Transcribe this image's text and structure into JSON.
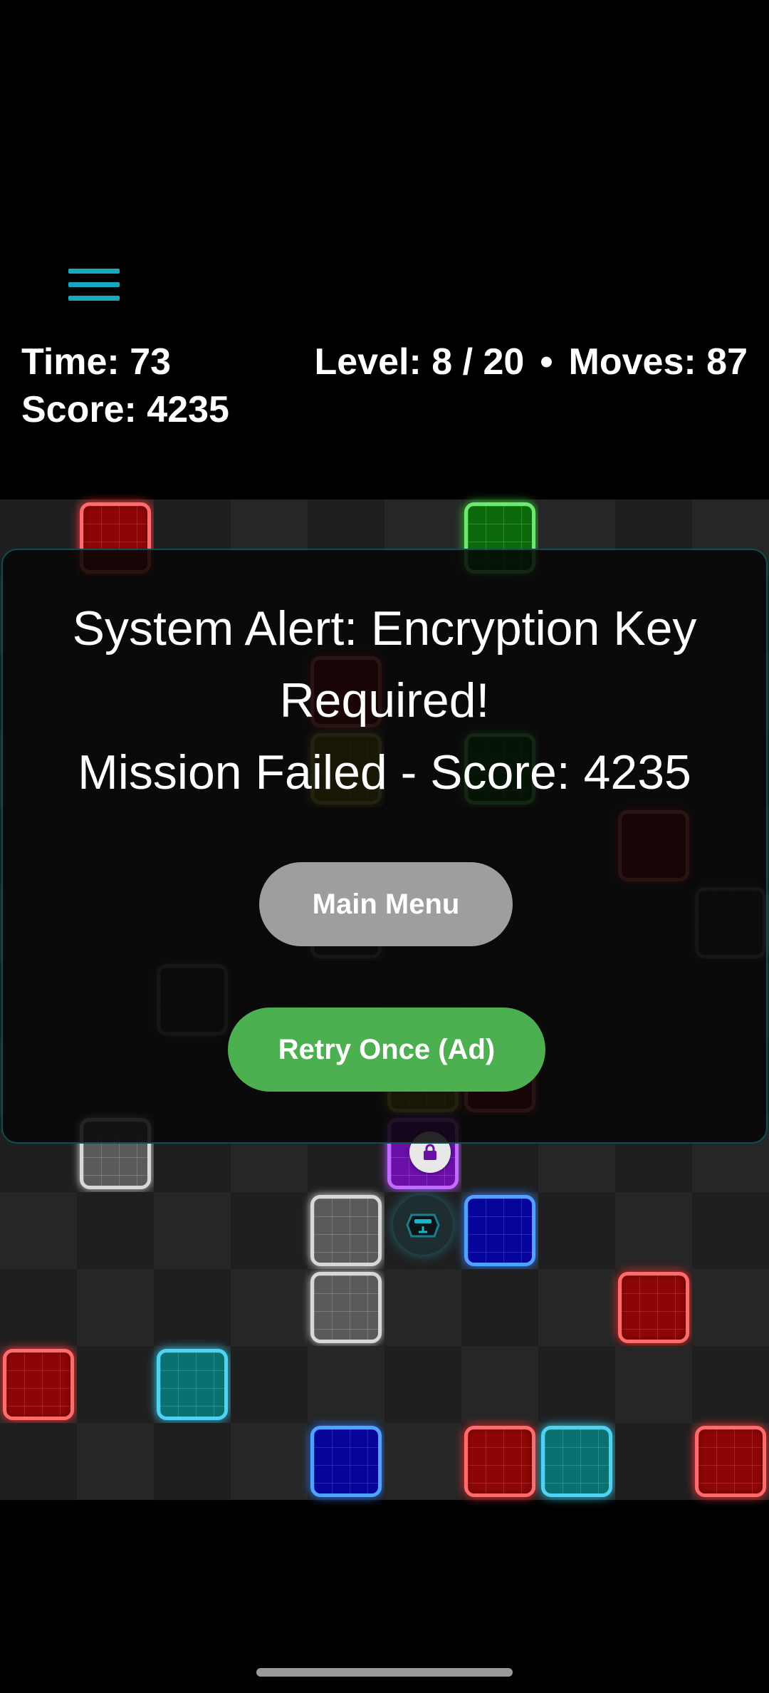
{
  "hud": {
    "time_text": "Time: 73",
    "score_text": "Score: 4235",
    "level_text": "Level: 8 / 20",
    "separator": "•",
    "moves_text": "Moves: 87"
  },
  "menu": {
    "icon": "hamburger-menu-icon",
    "color": "#16a8bf"
  },
  "dialog": {
    "line1": "System Alert: Encryption Key",
    "line2": "Required!",
    "line3": "Mission Failed - Score: 4235",
    "main_menu_label": "Main Menu",
    "retry_label": "Retry Once (Ad)",
    "main_menu_color": "#9e9e9e",
    "retry_color": "#4caf50"
  },
  "board": {
    "columns": 10,
    "rows": 13,
    "tiles": [
      {
        "row": 0,
        "col": 1,
        "color": "red"
      },
      {
        "row": 0,
        "col": 6,
        "color": "green"
      },
      {
        "row": 2,
        "col": 4,
        "color": "red"
      },
      {
        "row": 3,
        "col": 4,
        "color": "yellow"
      },
      {
        "row": 3,
        "col": 6,
        "color": "green"
      },
      {
        "row": 4,
        "col": 8,
        "color": "red"
      },
      {
        "row": 5,
        "col": 9,
        "color": "darkgray"
      },
      {
        "row": 5,
        "col": 4,
        "color": "darkgray"
      },
      {
        "row": 6,
        "col": 2,
        "color": "darkgray"
      },
      {
        "row": 7,
        "col": 5,
        "color": "yellow"
      },
      {
        "row": 7,
        "col": 6,
        "color": "red"
      },
      {
        "row": 8,
        "col": 1,
        "color": "gray"
      },
      {
        "row": 8,
        "col": 5,
        "color": "purple",
        "badge": "lock-icon"
      },
      {
        "row": 9,
        "col": 4,
        "color": "gray"
      },
      {
        "row": 9,
        "col": 6,
        "color": "blue"
      },
      {
        "row": 10,
        "col": 4,
        "color": "gray"
      },
      {
        "row": 10,
        "col": 8,
        "color": "red"
      },
      {
        "row": 11,
        "col": 0,
        "color": "red"
      },
      {
        "row": 11,
        "col": 2,
        "color": "teal"
      },
      {
        "row": 12,
        "col": 4,
        "color": "blue"
      },
      {
        "row": 12,
        "col": 6,
        "color": "red"
      },
      {
        "row": 12,
        "col": 7,
        "color": "teal"
      },
      {
        "row": 12,
        "col": 9,
        "color": "red"
      }
    ],
    "player": {
      "row": 9,
      "col": 5,
      "icon": "robot-icon"
    }
  }
}
